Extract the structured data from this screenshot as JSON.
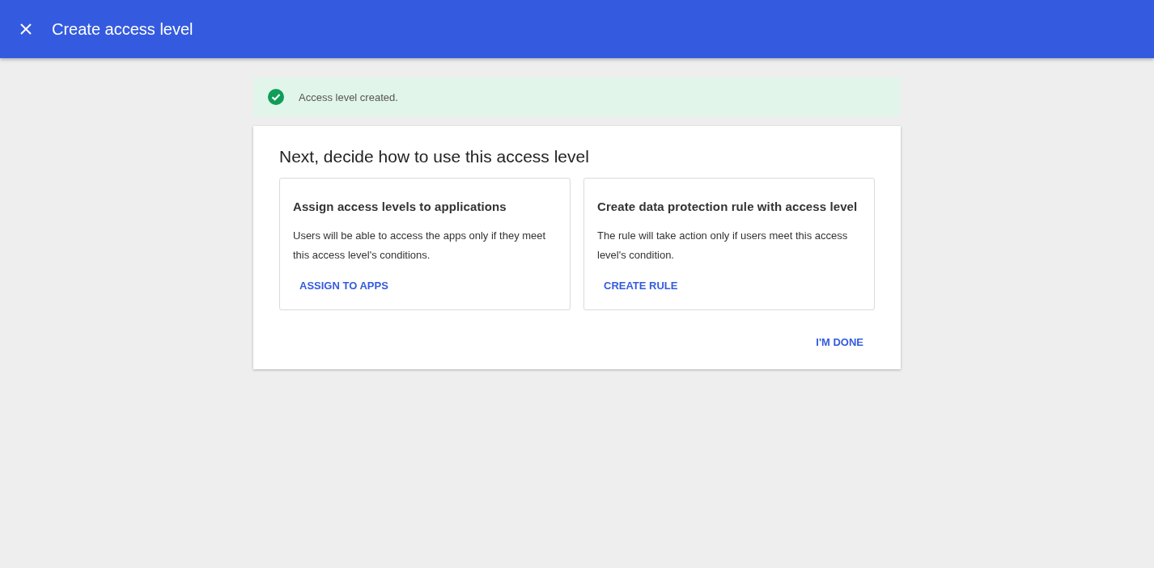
{
  "header": {
    "title": "Create access level"
  },
  "banner": {
    "message": "Access level created."
  },
  "card": {
    "heading": "Next, decide how to use this access level",
    "options": [
      {
        "title": "Assign access levels to applications",
        "description": "Users will be able to access the apps only if they meet this access level's conditions.",
        "action": "ASSIGN TO APPS"
      },
      {
        "title": "Create data protection rule with access level",
        "description": "The rule will take action only if users meet this access level's condition.",
        "action": "CREATE RULE"
      }
    ],
    "done": "I'M DONE"
  }
}
